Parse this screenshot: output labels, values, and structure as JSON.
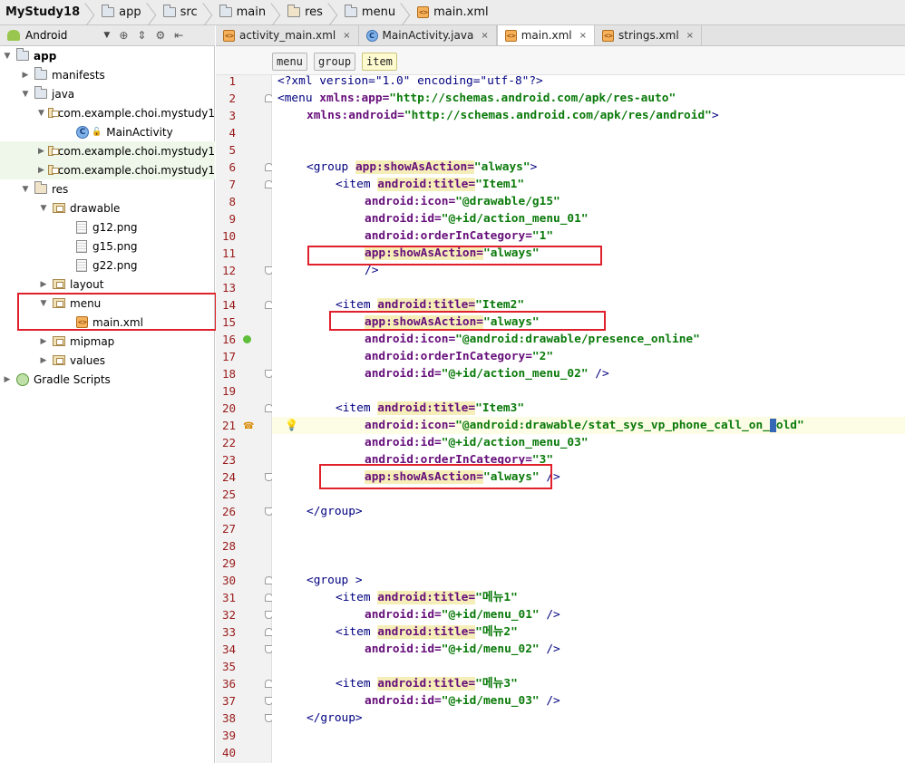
{
  "breadcrumbs": [
    "MyStudy18",
    "app",
    "src",
    "main",
    "res",
    "menu",
    "main.xml"
  ],
  "project_panel": {
    "view_mode": "Android",
    "tree": [
      {
        "label": "app",
        "icon": "module-icon",
        "expanded": true,
        "bold": true
      },
      {
        "label": "manifests",
        "icon": "folder-icon",
        "expanded": false
      },
      {
        "label": "java",
        "icon": "folder-icon",
        "expanded": true
      },
      {
        "label": "com.example.choi.mystudy1",
        "icon": "package-icon",
        "expanded": true
      },
      {
        "label": "MainActivity",
        "icon": "java-class-icon"
      },
      {
        "label": "com.example.choi.mystudy1",
        "icon": "package-icon",
        "expanded": false
      },
      {
        "label": "com.example.choi.mystudy1",
        "icon": "package-icon",
        "expanded": false
      },
      {
        "label": "res",
        "icon": "res-folder-icon",
        "expanded": true
      },
      {
        "label": "drawable",
        "icon": "package-icon",
        "expanded": true
      },
      {
        "label": "g12.png",
        "icon": "png-file-icon"
      },
      {
        "label": "g15.png",
        "icon": "png-file-icon"
      },
      {
        "label": "g22.png",
        "icon": "png-file-icon"
      },
      {
        "label": "layout",
        "icon": "package-icon",
        "expanded": false
      },
      {
        "label": "menu",
        "icon": "package-icon",
        "expanded": true
      },
      {
        "label": "main.xml",
        "icon": "xml-file-icon"
      },
      {
        "label": "mipmap",
        "icon": "package-icon",
        "expanded": false
      },
      {
        "label": "values",
        "icon": "package-icon",
        "expanded": false
      },
      {
        "label": "Gradle Scripts",
        "icon": "gradle-icon",
        "expanded": false
      }
    ]
  },
  "editor_tabs": [
    {
      "label": "activity_main.xml",
      "icon": "xml-file-icon",
      "active": false
    },
    {
      "label": "MainActivity.java",
      "icon": "java-class-icon",
      "active": false
    },
    {
      "label": "main.xml",
      "icon": "xml-file-icon",
      "active": true
    },
    {
      "label": "strings.xml",
      "icon": "xml-file-icon",
      "active": false
    }
  ],
  "editor_breadcrumb": [
    "menu",
    "group",
    "item"
  ],
  "tab_close_glyph": "×",
  "code_lines": [
    "1",
    "2",
    "3",
    "4",
    "5",
    "6",
    "7",
    "8",
    "9",
    "10",
    "11",
    "12",
    "13",
    "14",
    "15",
    "16",
    "17",
    "18",
    "19",
    "20",
    "21",
    "22",
    "23",
    "24",
    "25",
    "26",
    "27",
    "28",
    "29",
    "30",
    "31",
    "32",
    "33",
    "34",
    "35",
    "36",
    "37",
    "38",
    "39",
    "40"
  ],
  "code": {
    "l1": "<?xml version=\"1.0\" encoding=\"utf-8\"?>",
    "l2a": "<menu ",
    "l2b": "xmlns:app=",
    "l2c": "\"http://schemas.android.com/apk/res-auto\"",
    "l3a": "xmlns:android=",
    "l3b": "\"http://schemas.android.com/apk/res/android\"",
    "l3c": ">",
    "group_open": "<group ",
    "group_attr": "app:showAsAction=",
    "always_val": "\"always\"",
    "gt": ">",
    "item_open": "<item ",
    "title_attr": "android:title=",
    "item1_title": "\"Item1\"",
    "icon_attr": "android:icon=",
    "icon1_val": "\"@drawable/g15\"",
    "id_attr": "android:id=",
    "id1_val": "\"@+id/action_menu_01\"",
    "order_attr": "android:orderInCategory=",
    "order1_val": "\"1\"",
    "show_attr": "app:showAsAction=",
    "close_self": "/>",
    "item2_title": "\"Item2\"",
    "icon2_val": "\"@android:drawable/presence_online\"",
    "order2_val": "\"2\"",
    "id2_val": "\"@+id/action_menu_02\"",
    "close_self_sp": " />",
    "item3_title": "\"Item3\"",
    "icon3_val_a": "\"@android:drawable/stat_sys_vp_phone_call_on_",
    "icon3_val_b": "old\"",
    "id3_val": "\"@+id/action_menu_03\"",
    "order3_val": "\"3\"",
    "group_close": "</group>",
    "group2_open": "<group >",
    "m1_title": "\"메뉴1\"",
    "m1_id": "\"@+id/menu_01\"",
    "m2_title": "\"메뉴2\"",
    "m2_id": "\"@+id/menu_02\"",
    "m3_title": "\"메뉴3\"",
    "m3_id": "\"@+id/menu_03\""
  },
  "colors": {
    "highlight_box": "#e0202a",
    "tag": "#000080",
    "attribute": "#660e7a",
    "value": "#0a7a0a",
    "line_number": "#9a1b1b"
  }
}
